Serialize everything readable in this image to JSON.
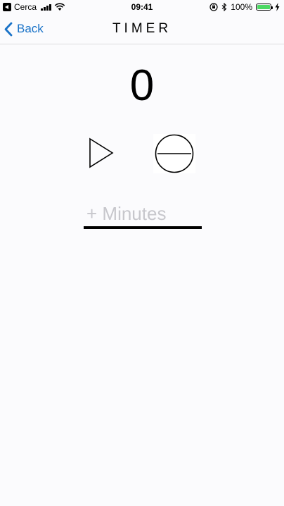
{
  "status_bar": {
    "carrier": "Cerca",
    "time": "09:41",
    "battery": "100%",
    "battery_level": 1.0
  },
  "nav": {
    "back_label": "Back",
    "title": "TIMER"
  },
  "timer": {
    "value": "0"
  },
  "minutes_input": {
    "placeholder": "+ Minutes",
    "value": ""
  },
  "colors": {
    "accent": "#1a73c8",
    "battery_green": "#4cd964",
    "placeholder": "#c7c7cc",
    "background": "#fbfbfd"
  }
}
